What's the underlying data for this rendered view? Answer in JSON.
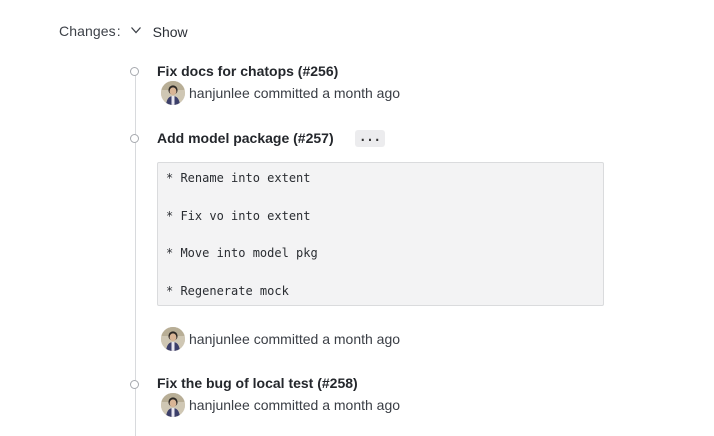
{
  "changes": {
    "label": "Changes",
    "colon": ":",
    "toggle_label": "Show"
  },
  "commits": [
    {
      "title": "Fix docs for chatops (#256)",
      "author": "hanjunlee",
      "time_text": "committed a month ago"
    },
    {
      "title": "Add model package (#257)",
      "expand_label": "...",
      "message_lines": [
        "* Rename into extent",
        "* Fix vo into extent",
        "* Move into model pkg",
        "* Regenerate mock"
      ],
      "author": "hanjunlee",
      "time_text": "committed a month ago"
    },
    {
      "title": "Fix the bug of local test (#258)",
      "author": "hanjunlee",
      "time_text": "committed a month ago"
    }
  ],
  "icons": {
    "toggle": "chevron-down-icon",
    "avatar": "user-avatar",
    "node": "commit-node-icon"
  },
  "colors": {
    "timeline": "#d8dadd",
    "node_border": "#a6a9ae",
    "message_bg": "#f3f3f4",
    "expand_bg": "#ececee"
  }
}
